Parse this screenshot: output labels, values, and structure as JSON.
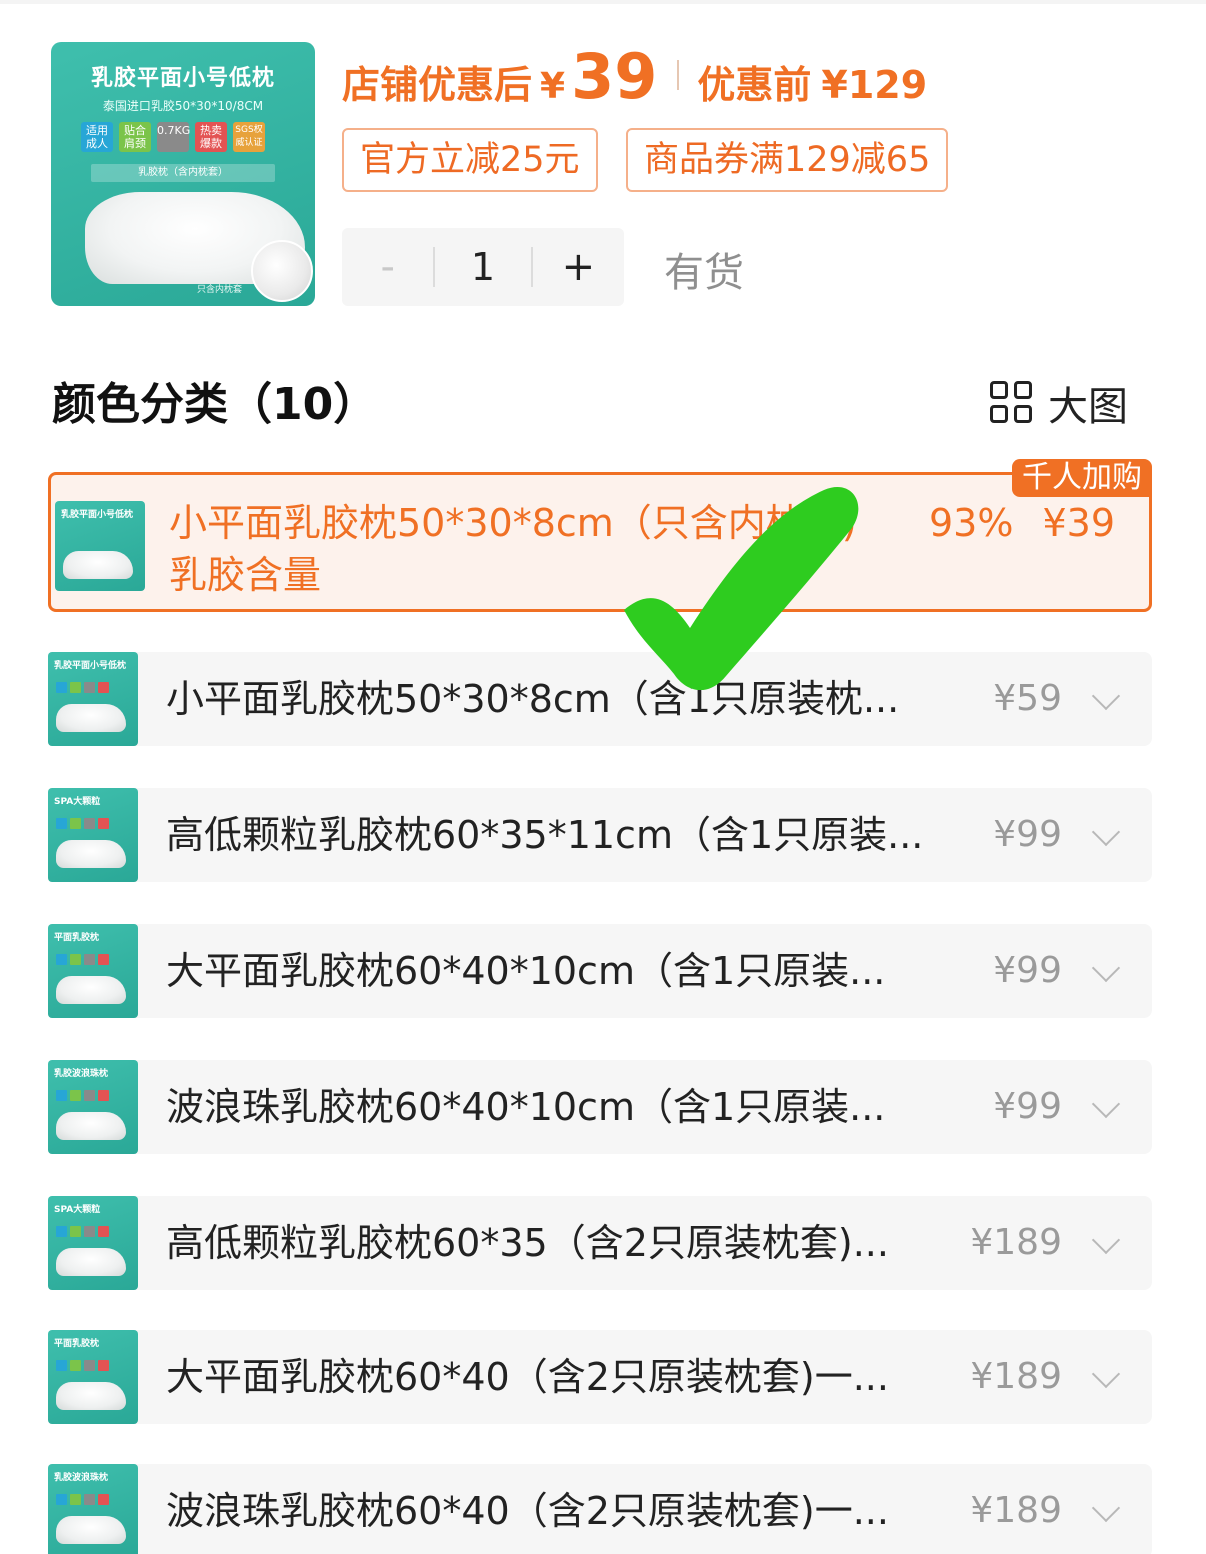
{
  "product": {
    "thumb": {
      "title": "乳胶平面小号低枕",
      "subtitle": "泰国进口乳胶50*30*10/8CM",
      "tags": [
        "适用成人",
        "贴合肩颈",
        "0.7KG",
        "热卖爆款",
        "SGS权威认证"
      ],
      "band": "乳胶枕（含内枕套）",
      "footnote": "只含内枕套"
    },
    "price_label": "店铺优惠后",
    "currency": "¥",
    "price": "39",
    "orig_label": "优惠前",
    "orig_price": "¥129",
    "coupons": [
      "官方立减25元",
      "商品券满129减65"
    ],
    "quantity": {
      "minus": "-",
      "value": "1",
      "plus": "+"
    },
    "stock": "有货"
  },
  "section": {
    "title": "颜色分类（10）",
    "view_label": "大图",
    "view_icon": "grid-icon"
  },
  "selected_option": {
    "badge": "千人加购",
    "name_line1": "小平面乳胶枕50*30*8cm（只含",
    "name_hidden": "内枕",
    "name_rest": "套)",
    "name_line2": "乳胶含量",
    "percent": "93%",
    "price": "¥39"
  },
  "options": [
    {
      "name": "小平面乳胶枕50*30*8cm（含1只原装枕...",
      "price": "¥59",
      "thumb_title": "乳胶平面小号低枕"
    },
    {
      "name": "高低颗粒乳胶枕60*35*11cm（含1只原装...",
      "price": "¥99",
      "thumb_title": "SPA大颗粒"
    },
    {
      "name": "大平面乳胶枕60*40*10cm（含1只原装...",
      "price": "¥99",
      "thumb_title": "平面乳胶枕"
    },
    {
      "name": "波浪珠乳胶枕60*40*10cm（含1只原装...",
      "price": "¥99",
      "thumb_title": "乳胶波浪珠枕"
    },
    {
      "name": "高低颗粒乳胶枕60*35（含2只原装枕套)...",
      "price": "¥189",
      "thumb_title": "SPA大颗粒"
    },
    {
      "name": "大平面乳胶枕60*40（含2只原装枕套)一...",
      "price": "¥189",
      "thumb_title": "平面乳胶枕"
    },
    {
      "name": "波浪珠乳胶枕60*40（含2只原装枕套)一...",
      "price": "¥189",
      "thumb_title": "乳胶波浪珠枕"
    }
  ],
  "colors": {
    "accent": "#f07024",
    "teal": "#2fb3a1",
    "check": "#2ecc1f"
  }
}
